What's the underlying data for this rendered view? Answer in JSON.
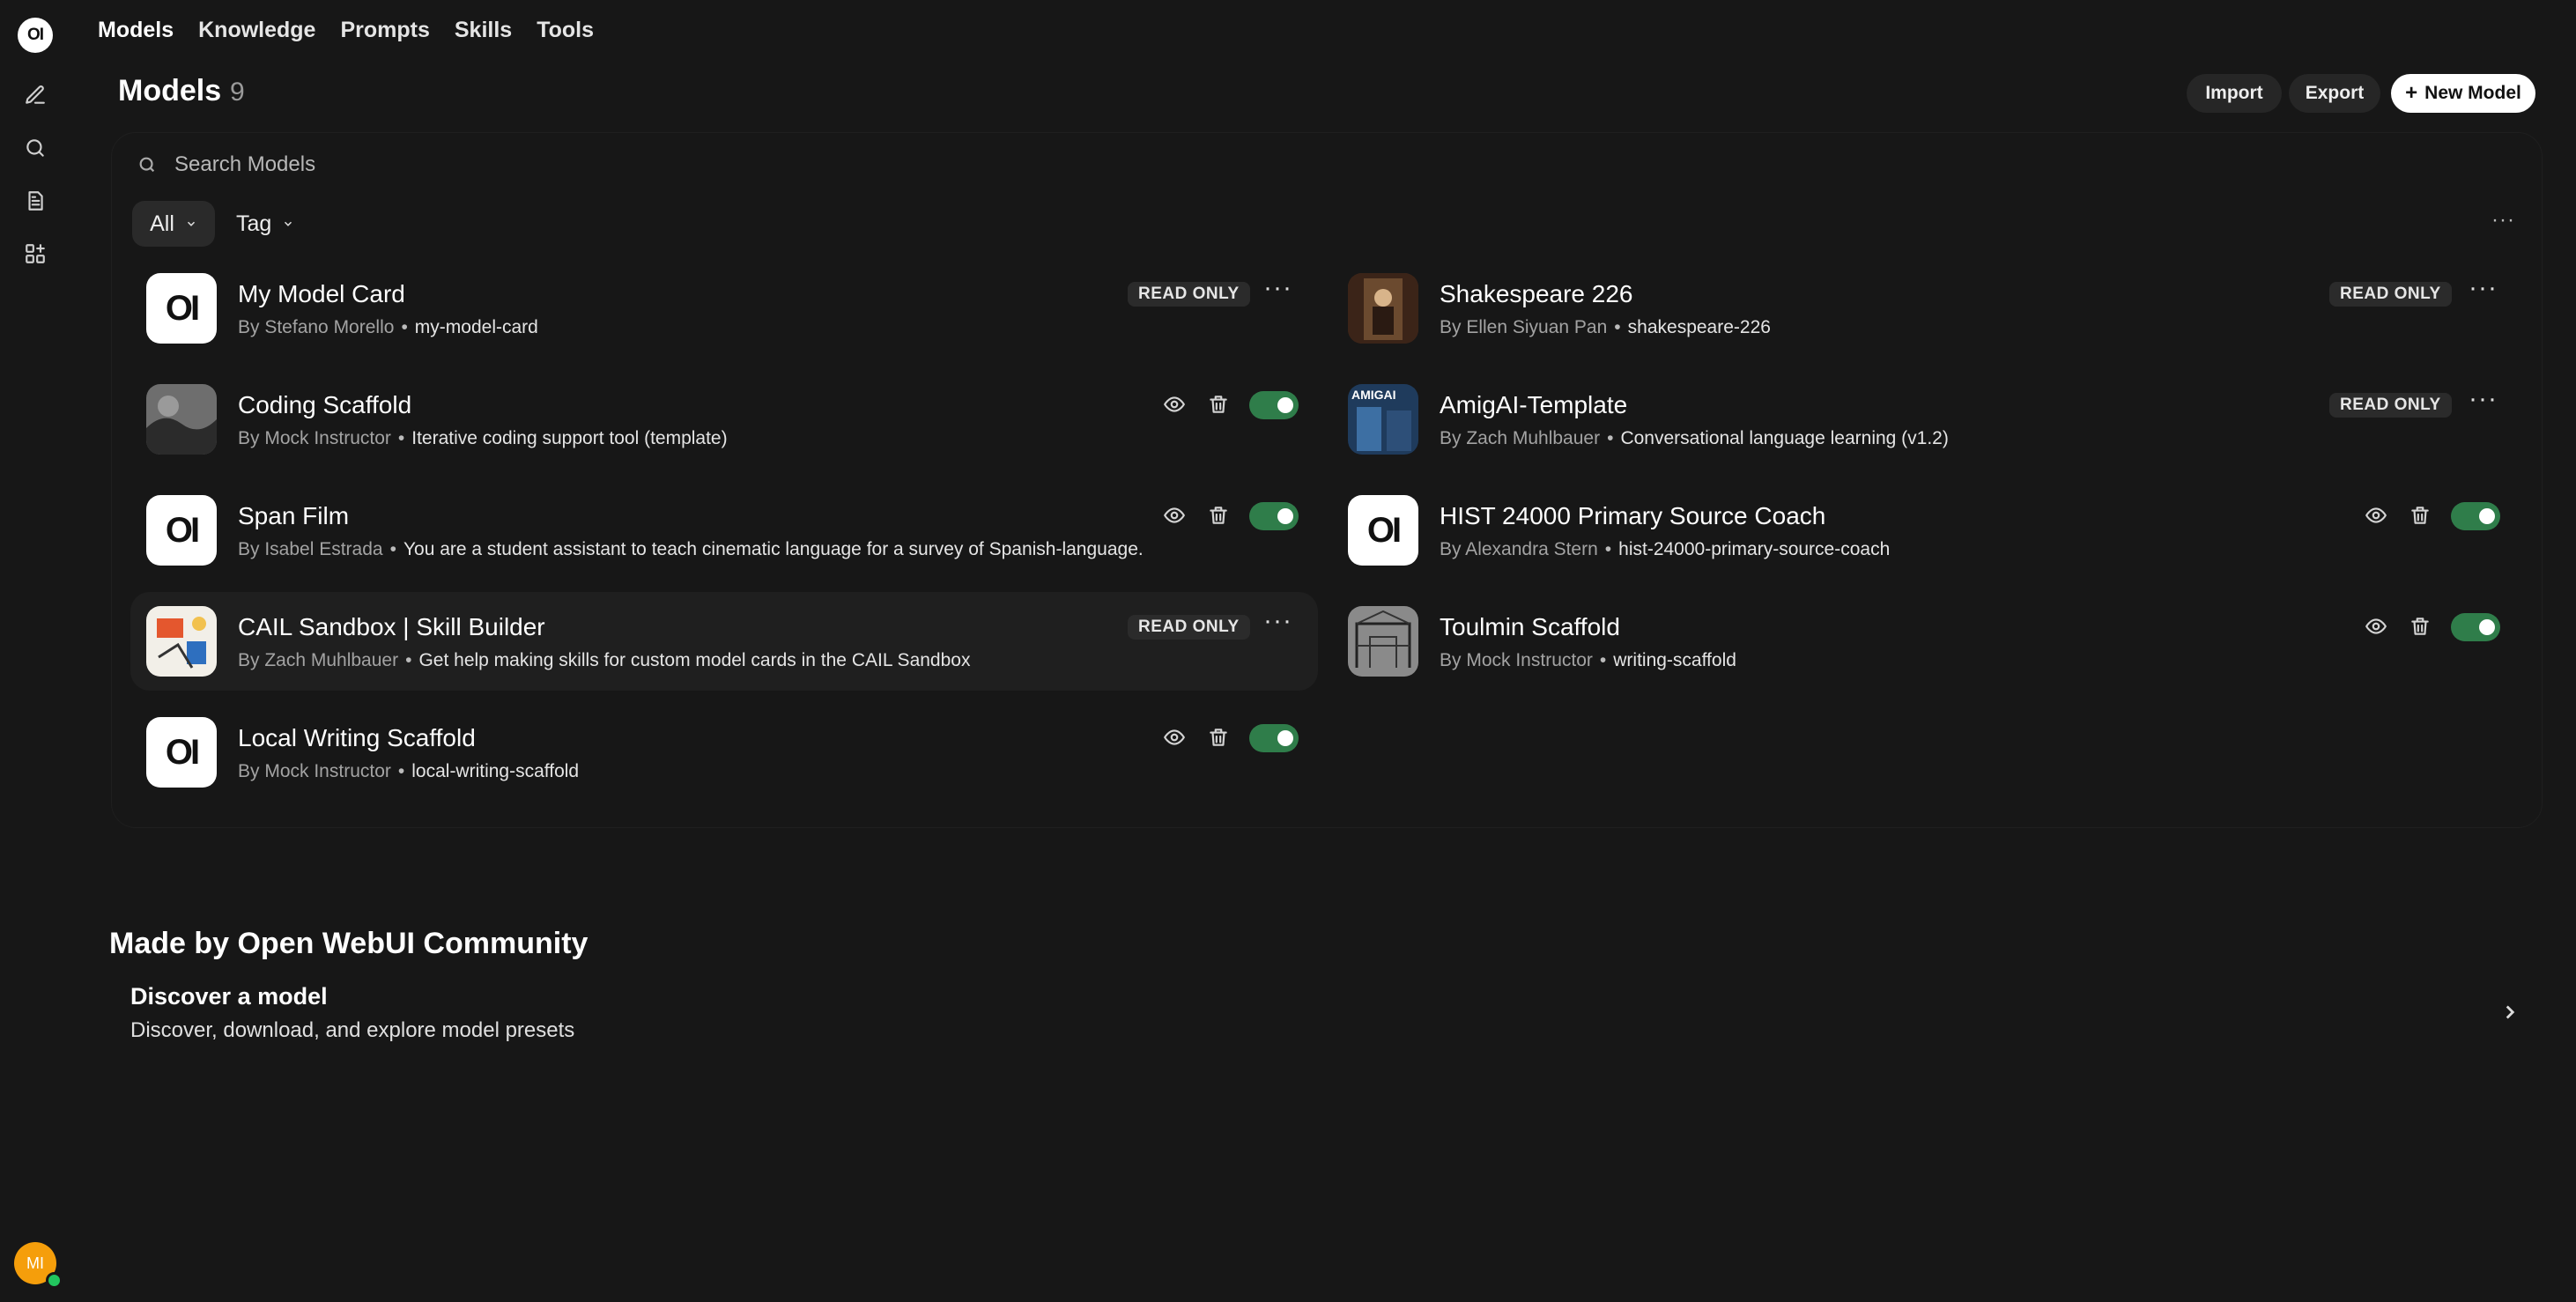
{
  "rail": {
    "logo": "OI",
    "avatar_initials": "MI"
  },
  "nav": {
    "items": [
      "Models",
      "Knowledge",
      "Prompts",
      "Skills",
      "Tools"
    ]
  },
  "header": {
    "title": "Models",
    "count": "9",
    "import_label": "Import",
    "export_label": "Export",
    "new_model_label": "New Model"
  },
  "search": {
    "placeholder": "Search Models"
  },
  "filters": {
    "all_label": "All",
    "tag_label": "Tag"
  },
  "models": [
    {
      "name": "My Model Card",
      "author": "By Stefano Morello",
      "detail": "my-model-card",
      "read_only": true,
      "badge": "READ ONLY",
      "thumb": "oi",
      "thumb_text": "OI"
    },
    {
      "name": "Shakespeare 226",
      "author": "By Ellen Siyuan Pan",
      "detail": "shakespeare-226",
      "read_only": true,
      "badge": "READ ONLY",
      "thumb": "portrait-painting"
    },
    {
      "name": "Coding Scaffold",
      "author": "By Mock Instructor",
      "detail": "Iterative coding support tool (template)",
      "read_only": false,
      "enabled": true,
      "thumb": "grayscale-photo"
    },
    {
      "name": "AmigAI-Template",
      "author": "By Zach Muhlbauer",
      "detail": "Conversational language learning (v1.2)",
      "read_only": true,
      "badge": "READ ONLY",
      "thumb": "amigai-photo",
      "thumb_text": "AMIGAI"
    },
    {
      "name": "Span Film",
      "author": "By Isabel Estrada",
      "detail": "You are a student assistant to teach cinematic language for a survey of Spanish-language.",
      "read_only": false,
      "enabled": true,
      "thumb": "oi",
      "thumb_text": "OI"
    },
    {
      "name": "HIST 24000 Primary Source Coach",
      "author": "By Alexandra Stern",
      "detail": "hist-24000-primary-source-coach",
      "read_only": false,
      "enabled": true,
      "thumb": "oi",
      "thumb_text": "OI"
    },
    {
      "name": "CAIL Sandbox | Skill Builder",
      "author": "By Zach Muhlbauer",
      "detail": "Get help making skills for custom model cards in the CAIL Sandbox",
      "read_only": true,
      "badge": "READ ONLY",
      "thumb": "sketch-illustration",
      "highlighted": true
    },
    {
      "name": "Toulmin Scaffold",
      "author": "By Mock Instructor",
      "detail": "writing-scaffold",
      "read_only": false,
      "enabled": true,
      "thumb": "building-sketch"
    },
    {
      "name": "Local Writing Scaffold",
      "author": "By Mock Instructor",
      "detail": "local-writing-scaffold",
      "read_only": false,
      "enabled": true,
      "thumb": "oi",
      "thumb_text": "OI"
    }
  ],
  "community": {
    "title": "Made by Open WebUI Community",
    "discover_title": "Discover a model",
    "discover_subtitle": "Discover, download, and explore model presets"
  },
  "colors": {
    "background": "#171717",
    "toggle_on": "#2f7d4a",
    "avatar": "#f59e0b"
  }
}
